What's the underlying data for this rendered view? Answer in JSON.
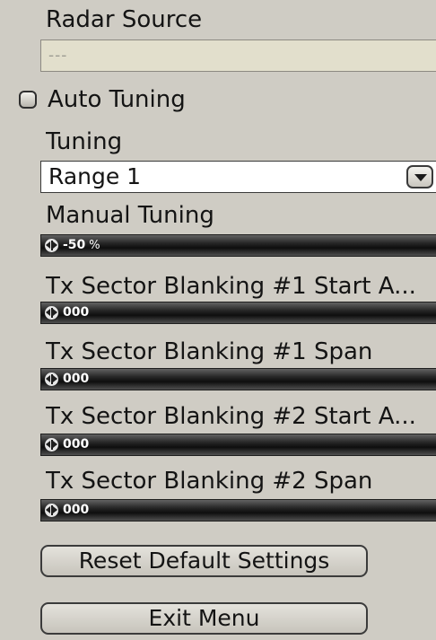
{
  "radar_source": {
    "label": "Radar Source",
    "value": "---"
  },
  "auto_tuning": {
    "label": "Auto Tuning",
    "checked": false
  },
  "tuning": {
    "label": "Tuning",
    "selected": "Range 1"
  },
  "sliders": [
    {
      "label": "Manual Tuning",
      "value": "-50",
      "unit": "%"
    },
    {
      "label": "Tx Sector Blanking #1 Start A...",
      "value": "000"
    },
    {
      "label": "Tx Sector Blanking #1 Span",
      "value": "000"
    },
    {
      "label": "Tx Sector Blanking #2 Start A...",
      "value": "000"
    },
    {
      "label": "Tx Sector Blanking #2 Span",
      "value": "000"
    }
  ],
  "buttons": {
    "reset": "Reset Default Settings",
    "exit": "Exit Menu"
  },
  "colors": {
    "panel_background": "#cfccc4",
    "readonly_field": "#e2dfcc",
    "slider_track": "#272727"
  }
}
